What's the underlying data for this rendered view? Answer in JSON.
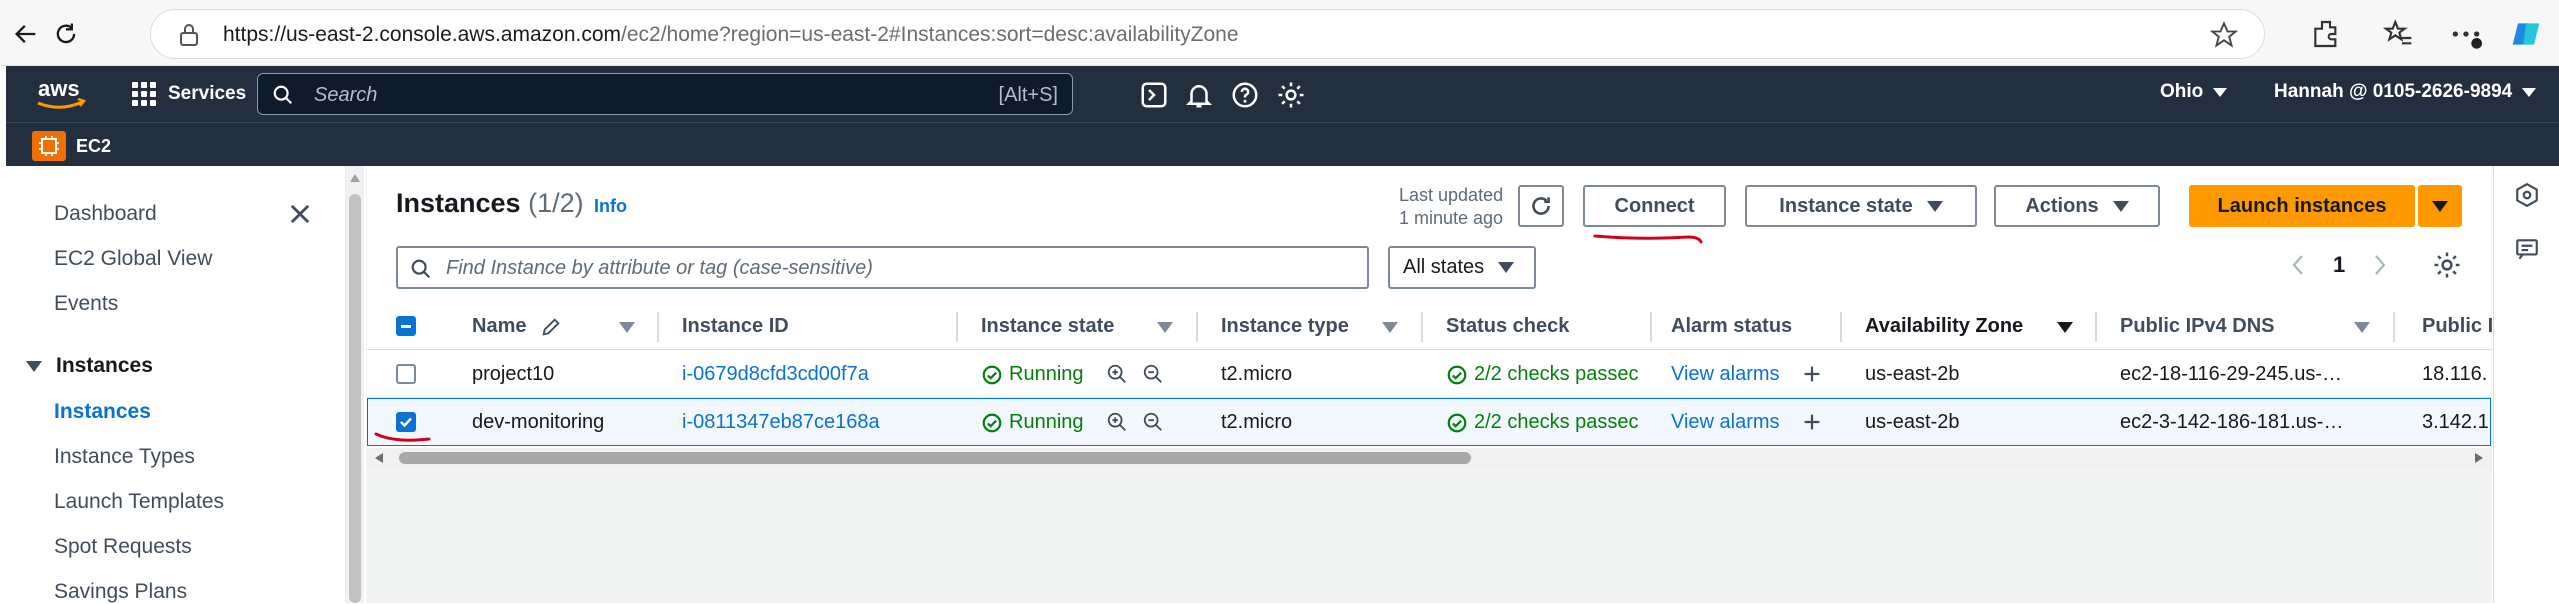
{
  "browser": {
    "url_host": "https://us-east-2.console.aws.amazon.com",
    "url_path": "/ec2/home?region=us-east-2#Instances:sort=desc:availabilityZone"
  },
  "top_nav": {
    "logo_text": "aws",
    "services_label": "Services",
    "search_placeholder": "Search",
    "search_shortcut": "[Alt+S]",
    "region": "Ohio",
    "account": "Hannah @ 0105-2626-9894"
  },
  "service_bar": {
    "service_name": "EC2"
  },
  "sidebar": {
    "items": [
      {
        "label": "Dashboard"
      },
      {
        "label": "EC2 Global View"
      },
      {
        "label": "Events"
      }
    ],
    "section": "Instances",
    "section_items": [
      {
        "label": "Instances",
        "active": true
      },
      {
        "label": "Instance Types"
      },
      {
        "label": "Launch Templates"
      },
      {
        "label": "Spot Requests"
      },
      {
        "label": "Savings Plans"
      }
    ]
  },
  "panel": {
    "title": "Instances",
    "count": "(1/2)",
    "info": "Info",
    "last_updated_line1": "Last updated",
    "last_updated_line2": "1 minute ago",
    "connect": "Connect",
    "instance_state": "Instance state",
    "actions": "Actions",
    "launch": "Launch instances",
    "filter_placeholder": "Find Instance by attribute or tag (case-sensitive)",
    "states_filter": "All states",
    "page": "1"
  },
  "table": {
    "columns": [
      "Name",
      "Instance ID",
      "Instance state",
      "Instance type",
      "Status check",
      "Alarm status",
      "Availability Zone",
      "Public IPv4 DNS",
      "Public I"
    ],
    "rows": [
      {
        "selected": false,
        "name": "project10",
        "instance_id": "i-0679d8cfd3cd00f7a",
        "state": "Running",
        "type": "t2.micro",
        "status": "2/2 checks passec",
        "alarm": "View alarms",
        "az": "us-east-2b",
        "dns": "ec2-18-116-29-245.us-…",
        "ip": "18.116."
      },
      {
        "selected": true,
        "name": "dev-monitoring",
        "instance_id": "i-0811347eb87ce168a",
        "state": "Running",
        "type": "t2.micro",
        "status": "2/2 checks passec",
        "alarm": "View alarms",
        "az": "us-east-2b",
        "dns": "ec2-3-142-186-181.us-…",
        "ip": "3.142.1"
      }
    ]
  },
  "colors": {
    "aws_nav": "#232f3e",
    "link": "#0972d3",
    "running": "#037f0c",
    "primary_button": "#ff9900",
    "annotation": "#d0021b"
  }
}
